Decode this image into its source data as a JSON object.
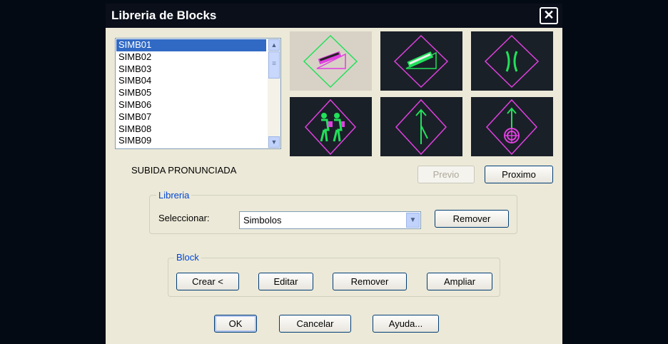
{
  "dialog": {
    "title": "Libreria de Blocks",
    "close_symbol": "✕"
  },
  "blocks_list": {
    "items": [
      "SIMB01",
      "SIMB02",
      "SIMB03",
      "SIMB04",
      "SIMB05",
      "SIMB06",
      "SIMB07",
      "SIMB08",
      "SIMB09"
    ],
    "selected": "SIMB01"
  },
  "thumbnails": [
    {
      "name": "thumb-subida-pronunciada-icon",
      "selected": true
    },
    {
      "name": "thumb-bajada-pronunciada-icon",
      "selected": false
    },
    {
      "name": "thumb-puente-angosto-icon",
      "selected": false
    },
    {
      "name": "thumb-peatones-icon",
      "selected": false
    },
    {
      "name": "thumb-incorporacion-icon",
      "selected": false
    },
    {
      "name": "thumb-circulo-icon",
      "selected": false
    }
  ],
  "preview": {
    "description": "SUBIDA PRONUNCIADA",
    "previo_label": "Previo",
    "proximo_label": "Proximo"
  },
  "libreria": {
    "group_label": "Libreria",
    "select_label": "Seleccionar:",
    "select_value": "Simbolos",
    "remove_label": "Remover"
  },
  "block": {
    "group_label": "Block",
    "crear_label": "Crear <",
    "editar_label": "Editar",
    "remover_label": "Remover",
    "ampliar_label": "Ampliar"
  },
  "footer": {
    "ok_label": "OK",
    "cancel_label": "Cancelar",
    "help_label": "Ayuda..."
  },
  "colors": {
    "sign_border": "#e040e0",
    "sign_symbol": "#22e05a",
    "selected_sign_border": "#22e05a",
    "selected_sign_symbol": "#e040e0",
    "list_selection": "#316ac5"
  }
}
